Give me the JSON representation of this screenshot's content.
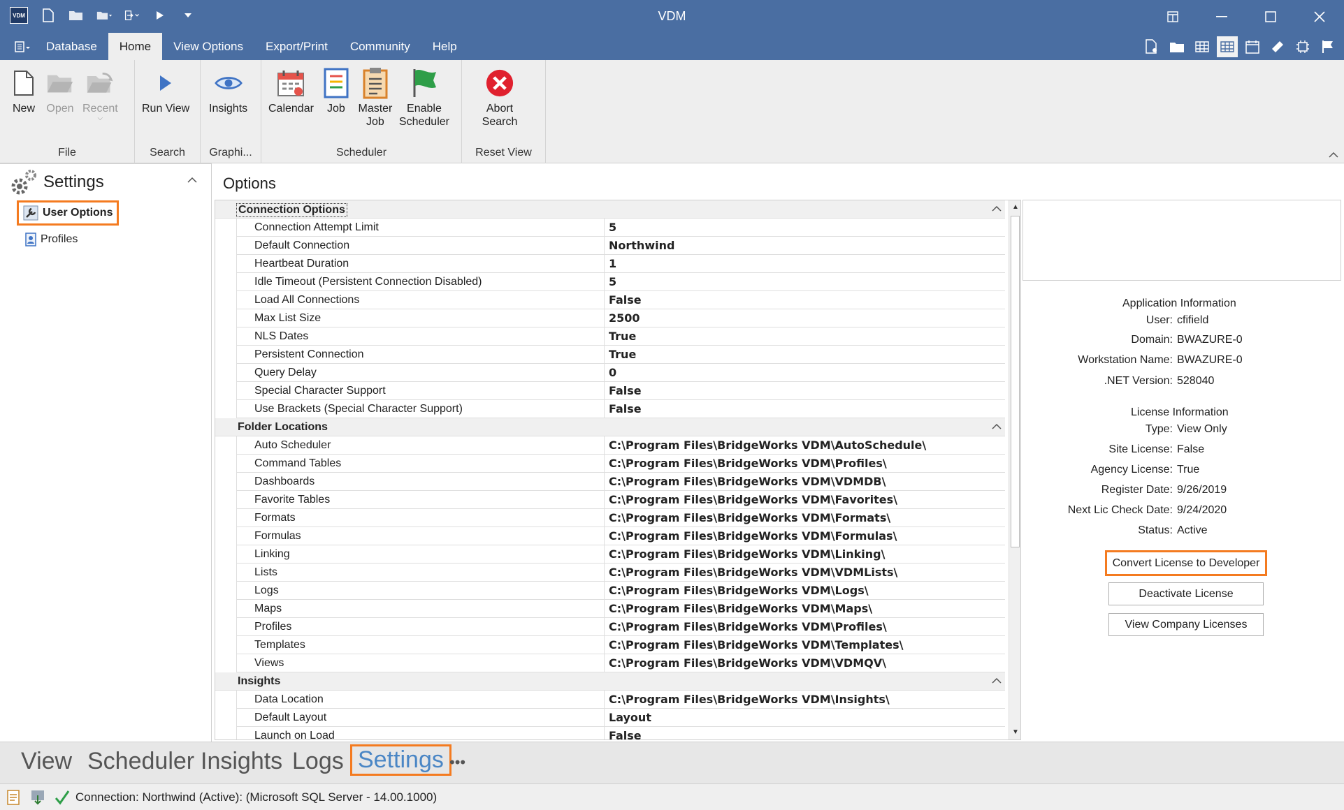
{
  "window": {
    "title": "VDM",
    "logo_text": "VDM"
  },
  "menu_tabs": [
    "Database",
    "Home",
    "View Options",
    "Export/Print",
    "Community",
    "Help"
  ],
  "ribbon": {
    "file": {
      "label": "File",
      "new": "New",
      "open": "Open",
      "recent": "Recent"
    },
    "search": {
      "label": "Search",
      "run_view": "Run View"
    },
    "graphics": {
      "label": "Graphi...",
      "insights": "Insights"
    },
    "scheduler": {
      "label": "Scheduler",
      "calendar": "Calendar",
      "job": "Job",
      "master_job": "Master Job",
      "enable_scheduler": "Enable Scheduler"
    },
    "reset_view": {
      "label": "Reset View",
      "abort_search": "Abort Search"
    }
  },
  "sidebar": {
    "title": "Settings",
    "items": [
      {
        "label": "User Options",
        "selected": true
      },
      {
        "label": "Profiles",
        "selected": false
      }
    ]
  },
  "main": {
    "title": "Options"
  },
  "categories": [
    {
      "title": "Connection Options",
      "rows": [
        {
          "key": "Connection Attempt Limit",
          "value": "5"
        },
        {
          "key": "Default Connection",
          "value": "Northwind"
        },
        {
          "key": "Heartbeat Duration",
          "value": "1"
        },
        {
          "key": "Idle Timeout (Persistent Connection Disabled)",
          "value": "5"
        },
        {
          "key": "Load All Connections",
          "value": "False"
        },
        {
          "key": "Max List Size",
          "value": "2500"
        },
        {
          "key": "NLS Dates",
          "value": "True"
        },
        {
          "key": "Persistent Connection",
          "value": "True"
        },
        {
          "key": "Query Delay",
          "value": "0"
        },
        {
          "key": "Special Character Support",
          "value": "False"
        },
        {
          "key": "Use Brackets (Special Character Support)",
          "value": "False"
        }
      ]
    },
    {
      "title": "Folder Locations",
      "rows": [
        {
          "key": "Auto Scheduler",
          "value": "C:\\Program Files\\BridgeWorks VDM\\AutoSchedule\\"
        },
        {
          "key": "Command Tables",
          "value": "C:\\Program Files\\BridgeWorks VDM\\Profiles\\"
        },
        {
          "key": "Dashboards",
          "value": "C:\\Program Files\\BridgeWorks VDM\\VDMDB\\"
        },
        {
          "key": "Favorite Tables",
          "value": "C:\\Program Files\\BridgeWorks VDM\\Favorites\\"
        },
        {
          "key": "Formats",
          "value": "C:\\Program Files\\BridgeWorks VDM\\Formats\\"
        },
        {
          "key": "Formulas",
          "value": "C:\\Program Files\\BridgeWorks VDM\\Formulas\\"
        },
        {
          "key": "Linking",
          "value": "C:\\Program Files\\BridgeWorks VDM\\Linking\\"
        },
        {
          "key": "Lists",
          "value": "C:\\Program Files\\BridgeWorks VDM\\VDMLists\\"
        },
        {
          "key": "Logs",
          "value": "C:\\Program Files\\BridgeWorks VDM\\Logs\\"
        },
        {
          "key": "Maps",
          "value": "C:\\Program Files\\BridgeWorks VDM\\Maps\\"
        },
        {
          "key": "Profiles",
          "value": "C:\\Program Files\\BridgeWorks VDM\\Profiles\\"
        },
        {
          "key": "Templates",
          "value": "C:\\Program Files\\BridgeWorks VDM\\Templates\\"
        },
        {
          "key": "Views",
          "value": "C:\\Program Files\\BridgeWorks VDM\\VDMQV\\"
        }
      ]
    },
    {
      "title": "Insights",
      "rows": [
        {
          "key": "Data Location",
          "value": "C:\\Program Files\\BridgeWorks VDM\\Insights\\"
        },
        {
          "key": "Default Layout",
          "value": "Layout"
        },
        {
          "key": "Launch on Load",
          "value": "False"
        }
      ]
    }
  ],
  "info": {
    "app_heading": "Application Information",
    "app_lines": [
      {
        "label": "User:",
        "value": "cfifield"
      },
      {
        "label": "Domain:",
        "value": "BWAZURE-0"
      },
      {
        "label": "Workstation Name:",
        "value": "BWAZURE-0"
      },
      {
        "label": ".NET Version:",
        "value": "528040"
      }
    ],
    "license_heading": "License Information",
    "license_lines": [
      {
        "label": "Type:",
        "value": "View Only"
      },
      {
        "label": "Site License:",
        "value": "False"
      },
      {
        "label": "Agency License:",
        "value": "True"
      },
      {
        "label": "Register Date:",
        "value": "9/26/2019"
      },
      {
        "label": "Next Lic Check Date:",
        "value": "9/24/2020"
      },
      {
        "label": "Status:",
        "value": "Active"
      }
    ],
    "buttons": {
      "convert": "Convert License to Developer",
      "deactivate": "Deactivate License",
      "company": "View Company Licenses"
    }
  },
  "bottom_tabs": [
    "View",
    "Scheduler",
    "Insights",
    "Logs",
    "Settings",
    "•••"
  ],
  "status": {
    "text": "Connection: Northwind (Active): (Microsoft SQL Server - 14.00.1000)"
  },
  "colors": {
    "accent": "#4a6ea2",
    "highlight": "#f47b20",
    "active_tab_text": "#4a86c5"
  }
}
